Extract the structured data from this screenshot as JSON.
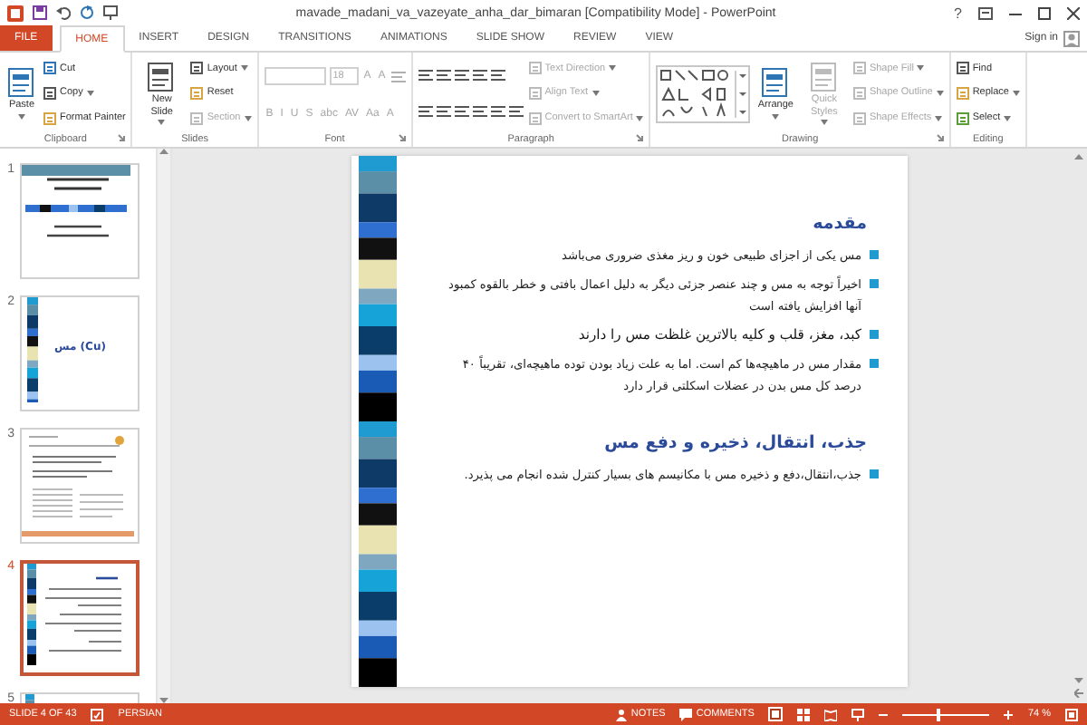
{
  "window": {
    "title": "mavade_madani_va_vazeyate_anha_dar_bimaran [Compatibility Mode] - PowerPoint",
    "help": "?"
  },
  "tabs": [
    {
      "label": "FILE",
      "kind": "file",
      "selected": false
    },
    {
      "label": "HOME",
      "kind": "tab",
      "selected": true
    },
    {
      "label": "INSERT",
      "kind": "tab",
      "selected": false
    },
    {
      "label": "DESIGN",
      "kind": "tab",
      "selected": false
    },
    {
      "label": "TRANSITIONS",
      "kind": "tab",
      "selected": false
    },
    {
      "label": "ANIMATIONS",
      "kind": "tab",
      "selected": false
    },
    {
      "label": "SLIDE SHOW",
      "kind": "tab",
      "selected": false
    },
    {
      "label": "REVIEW",
      "kind": "tab",
      "selected": false
    },
    {
      "label": "VIEW",
      "kind": "tab",
      "selected": false
    }
  ],
  "account": {
    "label": "Sign in"
  },
  "ribbon": {
    "groups": [
      {
        "label": "Clipboard",
        "launcher": true,
        "columns": [
          {
            "items": [
              {
                "kind": "large",
                "label": "Paste",
                "dropdown": true,
                "disabled": false
              }
            ]
          },
          {
            "items": [
              {
                "kind": "small",
                "label": "Cut",
                "disabled": false
              },
              {
                "kind": "small",
                "label": "Copy",
                "dropdown": true,
                "disabled": false
              },
              {
                "kind": "small",
                "label": "Format Painter",
                "disabled": false
              }
            ]
          }
        ]
      },
      {
        "label": "Slides",
        "launcher": false,
        "columns": [
          {
            "items": [
              {
                "kind": "large",
                "label": "New Slide",
                "dropdown": true,
                "disabled": false
              }
            ]
          },
          {
            "items": [
              {
                "kind": "small",
                "label": "Layout",
                "dropdown": true,
                "disabled": false
              },
              {
                "kind": "small",
                "label": "Reset",
                "disabled": false
              },
              {
                "kind": "small",
                "label": "Section",
                "dropdown": true,
                "disabled": true
              }
            ]
          }
        ]
      },
      {
        "label": "Font",
        "launcher": true,
        "columns": [
          {
            "items": [
              {
                "kind": "row",
                "parts": [
                  {
                    "kind": "field",
                    "wide": true,
                    "disabled": true
                  },
                  {
                    "kind": "field",
                    "text": "18",
                    "disabled": true
                  },
                  {
                    "kind": "glyph",
                    "text": "A",
                    "disabled": true
                  },
                  {
                    "kind": "glyph",
                    "text": "A",
                    "disabled": true
                  },
                  {
                    "kind": "icon",
                    "disabled": true
                  }
                ]
              },
              {
                "kind": "row",
                "parts": [
                  {
                    "kind": "glyph",
                    "text": "B",
                    "disabled": true
                  },
                  {
                    "kind": "glyph",
                    "text": "I",
                    "disabled": true
                  },
                  {
                    "kind": "glyph",
                    "text": "U",
                    "disabled": true
                  },
                  {
                    "kind": "glyph",
                    "text": "S",
                    "disabled": true
                  },
                  {
                    "kind": "glyph",
                    "text": "abc",
                    "disabled": true
                  },
                  {
                    "kind": "glyph",
                    "text": "AV",
                    "disabled": true
                  },
                  {
                    "kind": "glyph",
                    "text": "Aa",
                    "disabled": true
                  },
                  {
                    "kind": "glyph",
                    "text": "A",
                    "disabled": true
                  }
                ]
              }
            ]
          }
        ]
      },
      {
        "label": "Paragraph",
        "launcher": true,
        "columns": [
          {
            "items": [
              {
                "kind": "row",
                "parts": [
                  {
                    "kind": "icon",
                    "disabled": false
                  },
                  {
                    "kind": "icon",
                    "disabled": false
                  },
                  {
                    "kind": "icon",
                    "disabled": false
                  },
                  {
                    "kind": "icon",
                    "disabled": false
                  },
                  {
                    "kind": "icon",
                    "disabled": false
                  }
                ]
              },
              {
                "kind": "row",
                "parts": [
                  {
                    "kind": "icon",
                    "disabled": false
                  },
                  {
                    "kind": "icon",
                    "disabled": false
                  },
                  {
                    "kind": "icon",
                    "disabled": false
                  },
                  {
                    "kind": "icon",
                    "disabled": false
                  },
                  {
                    "kind": "icon",
                    "disabled": false
                  },
                  {
                    "kind": "icon",
                    "disabled": false
                  }
                ]
              }
            ]
          },
          {
            "items": [
              {
                "kind": "small",
                "label": "Text Direction",
                "dropdown": true,
                "disabled": true
              },
              {
                "kind": "small",
                "label": "Align Text",
                "dropdown": true,
                "disabled": true
              },
              {
                "kind": "small",
                "label": "Convert to SmartArt",
                "dropdown": true,
                "disabled": true
              }
            ]
          }
        ]
      },
      {
        "label": "Drawing",
        "launcher": true,
        "columns": [
          {
            "items": [
              {
                "kind": "gallery"
              }
            ]
          },
          {
            "items": [
              {
                "kind": "large",
                "label": "Arrange",
                "dropdown": true,
                "disabled": false
              }
            ]
          },
          {
            "items": [
              {
                "kind": "large",
                "label": "Quick Styles",
                "dropdown": true,
                "disabled": true
              }
            ]
          },
          {
            "items": [
              {
                "kind": "small",
                "label": "Shape Fill",
                "dropdown": true,
                "disabled": true
              },
              {
                "kind": "small",
                "label": "Shape Outline",
                "dropdown": true,
                "disabled": true
              },
              {
                "kind": "small",
                "label": "Shape Effects",
                "dropdown": true,
                "disabled": true
              }
            ]
          }
        ]
      },
      {
        "label": "Editing",
        "launcher": false,
        "columns": [
          {
            "items": [
              {
                "kind": "small",
                "label": "Find",
                "disabled": false
              },
              {
                "kind": "small",
                "label": "Replace",
                "dropdown": true,
                "disabled": false
              },
              {
                "kind": "small",
                "label": "Select",
                "dropdown": true,
                "disabled": false
              }
            ]
          }
        ]
      }
    ]
  },
  "slides": [
    {
      "number": "1",
      "kind": "title",
      "selected": false
    },
    {
      "number": "2",
      "kind": "section",
      "title": "مس (Cu)",
      "selected": false
    },
    {
      "number": "3",
      "kind": "document",
      "selected": false
    },
    {
      "number": "4",
      "kind": "content",
      "selected": true
    },
    {
      "number": "5",
      "kind": "content",
      "selected": false
    }
  ],
  "slide": {
    "blocks": [
      {
        "kind": "heading",
        "text": "مقدمه"
      },
      {
        "kind": "bullet",
        "text": "مس یکی از اجزای طبیعی خون و ریز مغذی ضروری می‌باشد",
        "emphasis": false
      },
      {
        "kind": "bullet",
        "text": "اخیراً توجه به مس و چند عنصر جزئی دیگر به دلیل اعمال بافتی و خطر بالقوه کمبود آنها افزایش یافته است",
        "emphasis": false
      },
      {
        "kind": "bullet",
        "text": "کبد، مغز، قلب و کلیه بالاترین غلظت مس را دارند",
        "emphasis": true
      },
      {
        "kind": "bullet",
        "text": "مقدار مس در ماهیچه‌ها کم است. اما به علت زیاد بودن توده ماهیچه‌ای، تقریباً ۴۰ درصد کل مس بدن در عضلات اسکلتی قرار دارد",
        "emphasis": false
      },
      {
        "kind": "heading",
        "text": "جذب، انتقال، ذخیره و دفع مس"
      },
      {
        "kind": "bullet",
        "text": "جذب،انتقال،دفع و ذخیره مس با مکانیسم های بسیار کنترل شده انجام می پذیرد.",
        "emphasis": false
      }
    ]
  },
  "status_bar": {
    "slide_indicator": "SLIDE 4 OF 43",
    "language": "PERSIAN",
    "notes": "NOTES",
    "comments": "COMMENTS",
    "zoom": {
      "label": "74 %",
      "level": 0.38
    }
  }
}
